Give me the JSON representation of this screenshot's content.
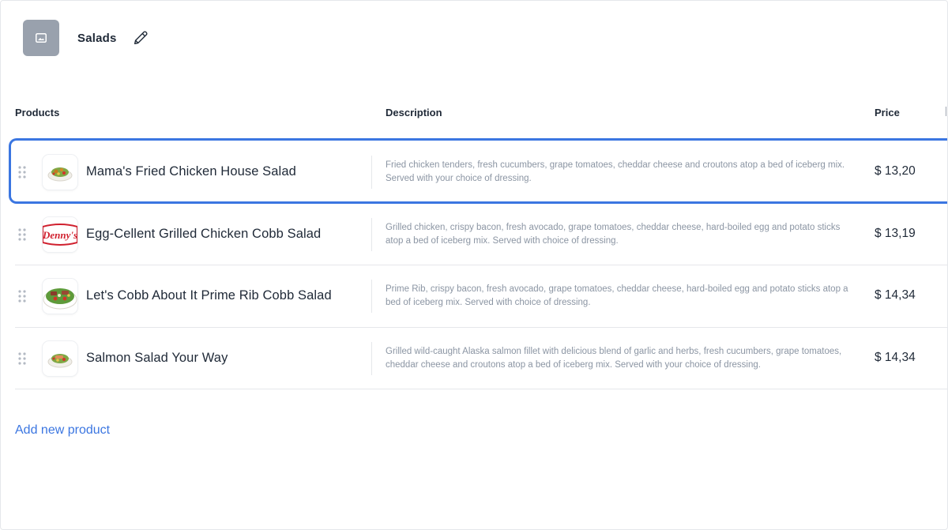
{
  "category": {
    "title": "Salads",
    "thumb_icon": "image-placeholder-icon",
    "edit_icon": "pencil-icon"
  },
  "table": {
    "headers": {
      "products": "Products",
      "description": "Description",
      "price": "Price"
    },
    "rows": [
      {
        "name": "Mama's Fried Chicken House Salad",
        "description": "Fried chicken tenders, fresh cucumbers, grape tomatoes, cheddar cheese and croutons atop a bed of iceberg mix. Served with your choice of dressing.",
        "price": "$ 13,20",
        "image": "salad-bowl-image",
        "selected": true
      },
      {
        "name": "Egg-Cellent Grilled Chicken Cobb Salad",
        "description": "Grilled chicken, crispy bacon, fresh avocado, grape tomatoes, cheddar cheese, hard-boiled egg and potato sticks atop a bed of iceberg mix. Served with choice of dressing.",
        "price": "$ 13,19",
        "image": "dennys-logo-image",
        "logo_text": "Denny's",
        "selected": false
      },
      {
        "name": "Let's Cobb About It Prime Rib Cobb Salad",
        "description": "Prime Rib, crispy bacon, fresh avocado, grape tomatoes, cheddar cheese, hard-boiled egg and potato sticks atop a bed of iceberg mix. Served with choice of dressing.",
        "price": "$ 14,34",
        "image": "cobb-salad-image",
        "selected": false
      },
      {
        "name": "Salmon Salad Your Way",
        "description": "Grilled wild-caught Alaska salmon fillet with delicious blend of garlic and herbs, fresh cucumbers, grape tomatoes, cheddar cheese and croutons atop a bed of iceberg mix. Served with your choice of dressing.",
        "price": "$ 14,34",
        "image": "salad-bowl-image",
        "selected": false
      }
    ]
  },
  "actions": {
    "add_product": "Add new product"
  },
  "colors": {
    "accent": "#3b76e1",
    "selection_outline": "#3b76e1",
    "category_thumb_bg": "#99a1ad",
    "description_text": "#8b95a3",
    "dennys_red": "#d0202e"
  }
}
